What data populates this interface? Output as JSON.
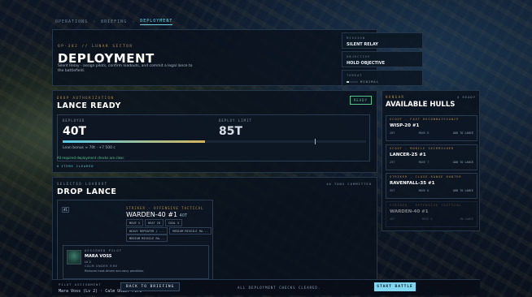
{
  "breadcrumb": [
    "OPERATIONS",
    "BRIEFING",
    "DEPLOYMENT"
  ],
  "breadcrumb_sep": "›",
  "header": {
    "ops_label": "OP-382 // LUNAR SECTOR",
    "title": "DEPLOYMENT",
    "description": "Silent Relay - assign pilots, confirm loadouts, and commit a legal lance to the battlefield.",
    "mission_key": "MISSION",
    "mission_value": "SILENT RELAY",
    "objective_key": "OBJECTIVE",
    "objective_value": "HOLD OBJECTIVE",
    "threat_key": "THREAT",
    "threat_value": "MINIMAL",
    "threat_level": 0.2
  },
  "drop_auth": {
    "label": "DROP AUTHORIZATION",
    "title": "LANCE READY",
    "badge": "READY",
    "deployed_key": "DEPLOYED",
    "deployed_value": "40T",
    "limit_key": "DEPLOY LIMIT",
    "limit_value": "85T",
    "deployed_tons": 40,
    "limit_tons": 85,
    "fill_fraction": 0.47,
    "limit_marker_fraction": 0.83,
    "lean_bonus": "Lean bonus ≈ 70t · +7 500 c",
    "checks_text": "All required deployment checks are clear.",
    "items_cleared": "ITEMS CLEARED",
    "items_count": "0"
  },
  "drop_lance": {
    "label": "SELECTED LOADOUT",
    "title": "DROP LANCE",
    "committed": "40 TONS COMMITTED",
    "slot_number": "#1",
    "role": "STRIKER - OFFENSIVE TACTICAL",
    "unit_name": "WARDEN-40 #1",
    "unit_tonnage": "40T",
    "stats": [
      "MOVE 5",
      "HEAT 20",
      "COOL 5"
    ],
    "weapons_row1": [
      "HEAVY REPEATER / ...",
      "MEDIUM MISSILE RA..."
    ],
    "weapons_row2": [
      "MEDIUM MISSILE RA..."
    ],
    "pilot_key": "ASSIGNED PILOT",
    "pilot_name": "MARA VOSS",
    "pilot_level": "LV 2",
    "pilot_trait": "CALM UNDER FIRE",
    "pilot_desc": "Reduces heat-driven accuracy penalties."
  },
  "hangar": {
    "label": "HANGAR",
    "ready_count": "4 READY",
    "title": "AVAILABLE HULLS",
    "hulls": [
      {
        "role": "SCOUT - FAST RECONNAISSANCE",
        "name": "WISP-20 #1",
        "tons": "20T",
        "move": "MOVE 8",
        "action": "ADD TO LANCE"
      },
      {
        "role": "SCOUT - MOBILE SKIRMISHER",
        "name": "LANCER-25 #1",
        "tons": "25T",
        "move": "MOVE 7",
        "action": "ADD TO LANCE"
      },
      {
        "role": "STRIKER - CLOSE-RANGE HUNTER",
        "name": "RAVENFALL-35 #1",
        "tons": "35T",
        "move": "MOVE 6",
        "action": "ADD TO LANCE"
      },
      {
        "role": "STRIKER - OFFENSIVE TACTICAL",
        "name": "WARDEN-40 #1",
        "tons": "40T",
        "move": "MOVE 5",
        "action": "IN LANCE"
      }
    ]
  },
  "footer": {
    "pilot_assignment_key": "PILOT ASSIGNMENT",
    "pilot_assignment_value": "Mara Voss (Lv 2) · Calm Under Fire",
    "back_button": "BACK TO BRIEFING",
    "status": "ALL DEPLOYMENT CHECKS CLEARED.",
    "start_button": "START BATTLE"
  },
  "colors": {
    "accent": "#7fd6ee",
    "gold": "#b5904a",
    "ready_green": "#57c38a"
  }
}
